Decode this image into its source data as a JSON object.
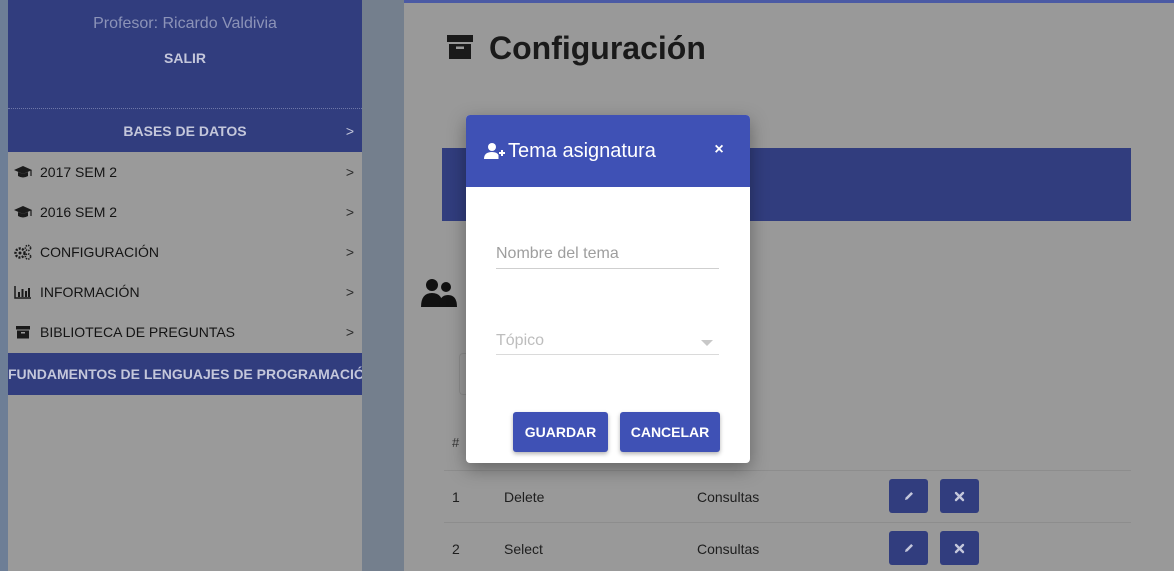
{
  "sidebar": {
    "professor": "Profesor: Ricardo Valdivia",
    "logout": "SALIR",
    "databases": "BASES DE DATOS",
    "chevron": ">",
    "items": [
      {
        "label": "2017 SEM 2",
        "icon": "graduation-cap-icon"
      },
      {
        "label": "2016 SEM 2",
        "icon": "graduation-cap-icon"
      },
      {
        "label": "CONFIGURACIÓN",
        "icon": "gears-icon"
      },
      {
        "label": "INFORMACIÓN",
        "icon": "bar-chart-icon"
      },
      {
        "label": "BIBLIOTECA DE PREGUNTAS",
        "icon": "archive-icon"
      }
    ],
    "active_course": "FUNDAMENTOS DE LENGUAJES DE PROGRAMACIÓN"
  },
  "main": {
    "title": "Configuración",
    "title_icon": "archive-icon",
    "table": {
      "header_num": "#",
      "rows": [
        {
          "num": "1",
          "name": "Delete",
          "topic": "Consultas"
        },
        {
          "num": "2",
          "name": "Select",
          "topic": "Consultas"
        }
      ]
    }
  },
  "modal": {
    "title": "Tema asignatura",
    "close": "×",
    "name_placeholder": "Nombre del tema",
    "name_value": "",
    "topic_placeholder": "Tópico",
    "save": "GUARDAR",
    "cancel": "CANCELAR"
  },
  "colors": {
    "primary": "#3f51b5",
    "sidebar_dark": "#313d7e",
    "overlay_bg": "#999999"
  }
}
